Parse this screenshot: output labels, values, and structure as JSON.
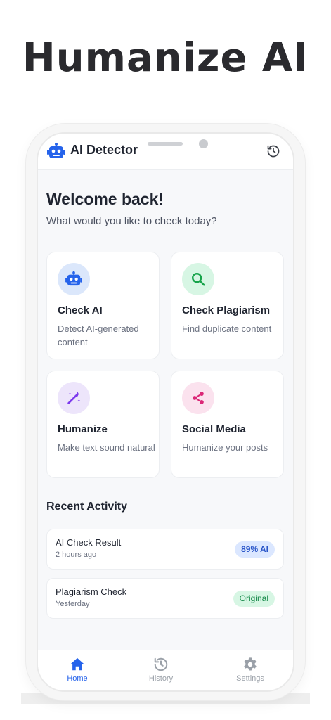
{
  "headline": "Humanize AI",
  "app": {
    "title": "AI Detector"
  },
  "welcome": {
    "title": "Welcome back!",
    "subtitle": "What would you like to check today?"
  },
  "cards": [
    {
      "title": "Check AI",
      "desc": "Detect AI-generated content",
      "icon": "robot-icon",
      "color": "#2563eb",
      "bg": "#dbe7fb"
    },
    {
      "title": "Check Plagiarism",
      "desc": "Find duplicate content",
      "icon": "search-icon",
      "color": "#16a34a",
      "bg": "#d7f6e4"
    },
    {
      "title": "Humanize",
      "desc": "Make text sound natural",
      "icon": "magic-wand-icon",
      "color": "#7c3aed",
      "bg": "#ede5fb"
    },
    {
      "title": "Social Media",
      "desc": "Humanize your posts",
      "icon": "share-icon",
      "color": "#db2777",
      "bg": "#fbe2ee"
    }
  ],
  "recent": {
    "title": "Recent Activity",
    "items": [
      {
        "title": "AI Check Result",
        "time": "2 hours ago",
        "badge": "89% AI"
      },
      {
        "title": "Plagiarism Check",
        "time": "Yesterday",
        "badge": "Original"
      }
    ]
  },
  "nav": [
    {
      "label": "Home",
      "icon": "home-icon",
      "active": true
    },
    {
      "label": "History",
      "icon": "history-icon",
      "active": false
    },
    {
      "label": "Settings",
      "icon": "gear-icon",
      "active": false
    }
  ],
  "colors": {
    "accent": "#2563eb",
    "text": "#1f2430",
    "muted": "#6b7180"
  }
}
